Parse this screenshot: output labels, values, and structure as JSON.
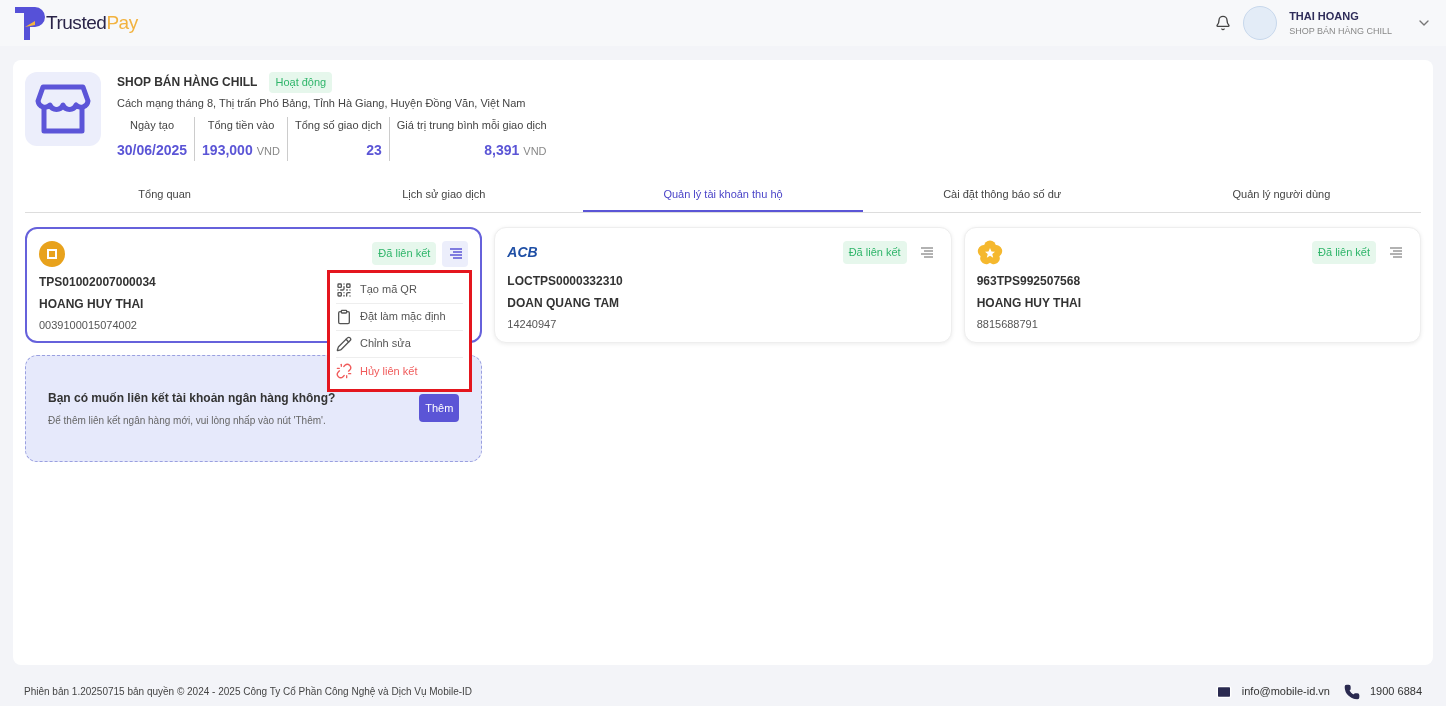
{
  "header": {
    "logo": {
      "part1": "Trusted",
      "part2": "Pay"
    },
    "user": {
      "name": "THAI HOANG",
      "shop": "SHOP BÁN HÀNG CHILL"
    }
  },
  "shop": {
    "name": "SHOP BÁN HÀNG CHILL",
    "status": "Hoạt động",
    "address": "Cách mạng tháng 8, Thị trấn Phó Bảng, Tỉnh Hà Giang, Huyện Đồng Văn, Việt Nam",
    "stats": [
      {
        "label": "Ngày tạo",
        "value": "30/06/2025"
      },
      {
        "label": "Tổng tiền vào",
        "value": "193,000",
        "unit": "VND"
      },
      {
        "label": "Tổng số giao dịch",
        "value": "23"
      },
      {
        "label": "Giá trị trung bình mỗi giao dịch",
        "value": "8,391",
        "unit": "VND"
      }
    ]
  },
  "tabs": [
    {
      "label": "Tổng quan",
      "selected": false
    },
    {
      "label": "Lịch sử giao dịch",
      "selected": false
    },
    {
      "label": "Quản lý tài khoản thu hộ",
      "selected": true
    },
    {
      "label": "Cài đặt thông báo số dư",
      "selected": false
    },
    {
      "label": "Quản lý người dùng",
      "selected": false
    }
  ],
  "accounts": [
    {
      "kind": "coin",
      "status": "Đã liên kết",
      "code": "TPS01002007000034",
      "holder": "HOANG HUY THAI",
      "number": "0039100015074002",
      "selected": true,
      "menu_open": true
    },
    {
      "kind": "text",
      "logo_text": "ACB",
      "status": "Đã liên kết",
      "code": "LOCTPS0000332310",
      "holder": "DOAN QUANG TAM",
      "number": "14240947",
      "selected": false,
      "menu_open": false
    },
    {
      "kind": "flower",
      "status": "Đã liên kết",
      "code": "963TPS992507568",
      "holder": "HOANG HUY THAI",
      "number": "8815688791",
      "selected": false,
      "menu_open": false
    }
  ],
  "menu": [
    {
      "kind": "qr",
      "label": "Tạo mã QR",
      "danger": false
    },
    {
      "kind": "default",
      "label": "Đặt làm mặc định",
      "danger": false
    },
    {
      "kind": "edit",
      "label": "Chỉnh sửa",
      "danger": false
    },
    {
      "kind": "unlink",
      "label": "Hủy liên kết",
      "danger": true
    }
  ],
  "add_prompt": {
    "title": "Bạn có muốn liên kết tài khoản ngân hàng không?",
    "hint": "Để thêm liên kết ngân hàng mới, vui lòng nhấp vào nút 'Thêm'.",
    "button": "Thêm"
  },
  "footer": {
    "copyright": "Phiên bản 1.20250715 bản quyền © 2024 - 2025 Công Ty Cổ Phần Công Nghệ và Dịch Vụ Mobile-ID",
    "email": "info@mobile-id.vn",
    "phone": "1900 6884"
  }
}
